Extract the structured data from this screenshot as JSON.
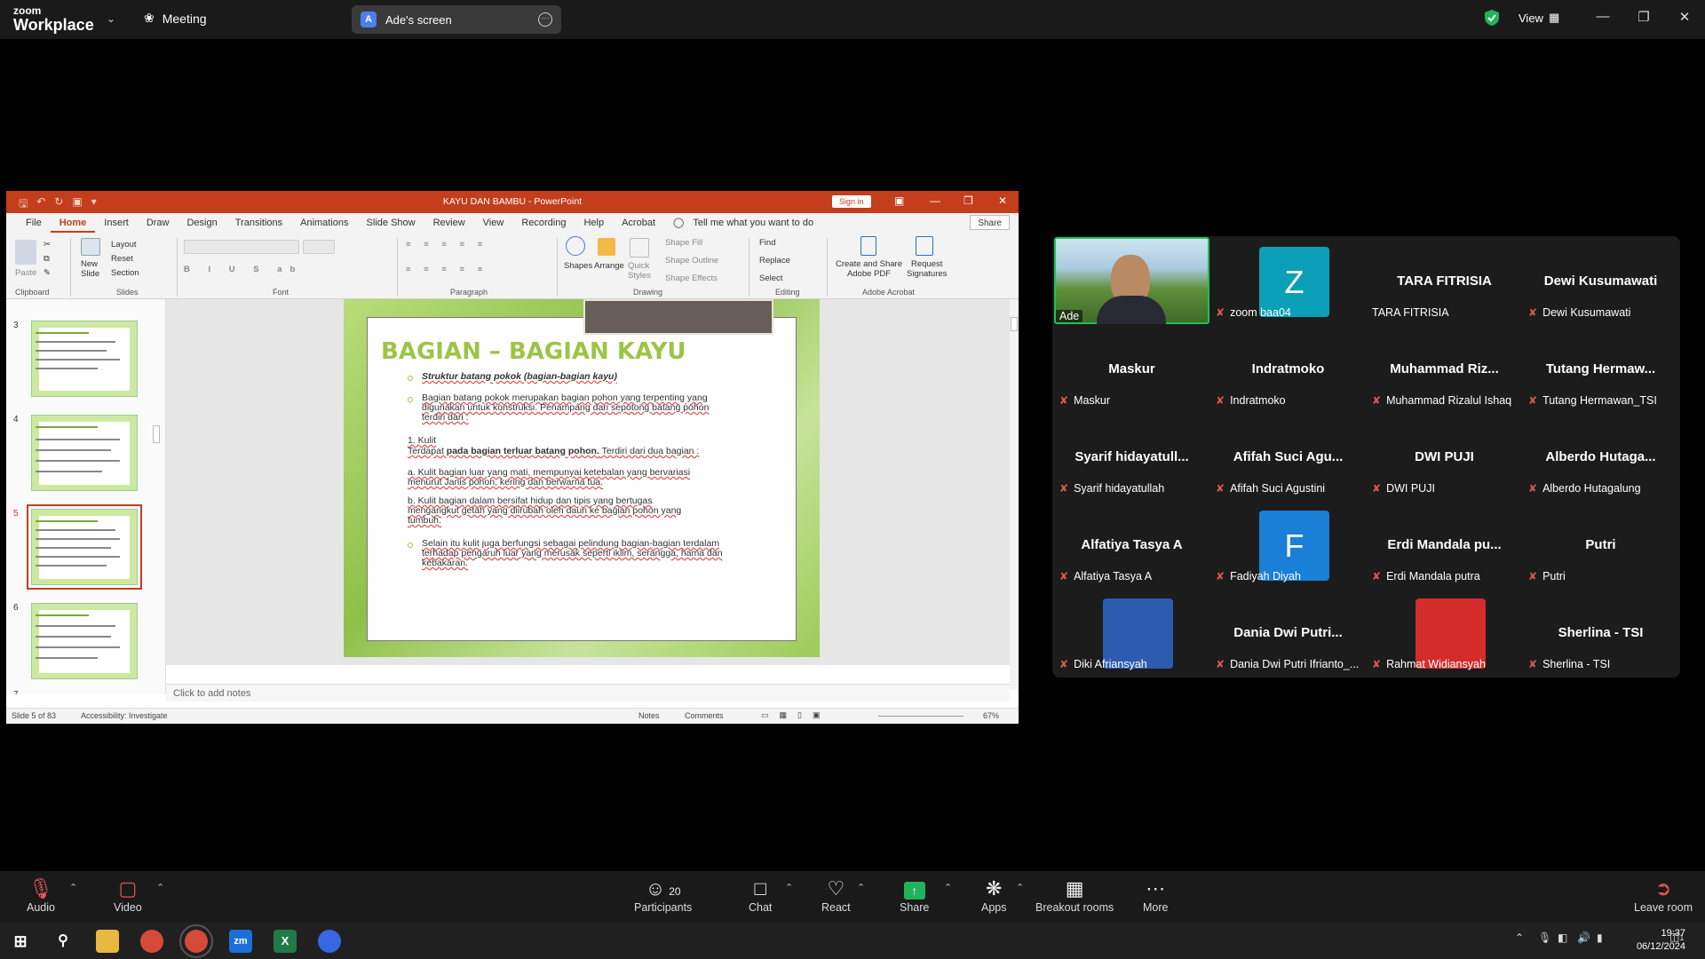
{
  "app": {
    "brand_line1": "zoom",
    "brand_line2": "Workplace",
    "meeting_label": "Meeting",
    "screen_share_label": "Ade's screen",
    "screen_badge": "A",
    "view_label": "View"
  },
  "ppt": {
    "title": "KAYU DAN BAMBU  -  PowerPoint",
    "sign_in": "Sign in",
    "tabs": [
      "File",
      "Home",
      "Insert",
      "Draw",
      "Design",
      "Transitions",
      "Animations",
      "Slide Show",
      "Review",
      "View",
      "Recording",
      "Help",
      "Acrobat"
    ],
    "tell_me": "Tell me what you want to do",
    "share": "Share",
    "ribbon": {
      "paste": "Paste",
      "new_slide": "New\nSlide",
      "layout": "Layout",
      "reset": "Reset",
      "section": "Section",
      "shapes": "Shapes",
      "arrange": "Arrange",
      "quick_styles": "Quick\nStyles",
      "shape_fill": "Shape Fill",
      "shape_outline": "Shape Outline",
      "shape_effects": "Shape Effects",
      "find": "Find",
      "replace": "Replace",
      "select": "Select",
      "create_share": "Create and Share\nAdobe PDF",
      "request_sig": "Request\nSignatures",
      "groups": {
        "clipboard": "Clipboard",
        "slides": "Slides",
        "font": "Font",
        "paragraph": "Paragraph",
        "drawing": "Drawing",
        "editing": "Editing",
        "adobe": "Adobe Acrobat"
      }
    },
    "thumb_numbers": [
      "3",
      "4",
      "5",
      "6",
      "7"
    ],
    "slide": {
      "title": "BAGIAN – BAGIAN KAYU",
      "b1": "Struktur batang pokok (bagian-bagian kayu)",
      "b2a": "Bagian batang pokok merupakan bagian pohon yang  terpenting yang",
      "b2b": "digunakan untuk konstruksi. Penampang dari sepotong batang pohon",
      "b2c": "terdiri dari :",
      "k1": "1. Kulit",
      "k2a": "Terdapat ",
      "k2b": "pada bagian terluar batang pohon.",
      "k2c": " Terdiri dari dua bagian :",
      "a1": "a. Kulit bagian luar yang mati, mempunyai ketebalan yang bervariasi",
      "a2": "menurut Janis pohon, kering dan berwarna tua.",
      "bb1": "b. Kulit bagian dalam bersifat hidup dan tipis yang bertugas",
      "bb2": "mengangkut getah yang diirubah oleh daun ke bagian pohon yang",
      "bb3": "tumbuh.",
      "c1": "Selain itu kulit juga berfungsi sebagai pelindung bagian-bagian terdalam",
      "c2": "terhadap pengaruh luar yang merusak seperti iklim, serangga, hama dan",
      "c3": "kebakaran."
    },
    "notes": "Click to add notes",
    "status_slide": "Slide 5 of 83",
    "accessibility": "Accessibility: Investigate",
    "notes_btn": "Notes",
    "comments_btn": "Comments",
    "zoom_pct": "67%"
  },
  "participants": [
    {
      "label": "Ade",
      "muted": false,
      "type": "video"
    },
    {
      "label": "zoom baa04",
      "muted": true,
      "type": "avatar",
      "initial": "Z",
      "color": "#0ca0b8"
    },
    {
      "name": "TARA FITRISIA",
      "label": "TARA FITRISIA",
      "muted": false
    },
    {
      "name": "Dewi Kusumawati",
      "label": "Dewi Kusumawati",
      "muted": true
    },
    {
      "name": "Maskur",
      "label": "Maskur",
      "muted": true
    },
    {
      "name": "Indratmoko",
      "label": "Indratmoko",
      "muted": true
    },
    {
      "name": "Muhammad  Riz...",
      "label": "Muhammad Rizalul Ishaq",
      "muted": true
    },
    {
      "name": "Tutang  Hermaw...",
      "label": "Tutang Hermawan_TSI",
      "muted": true
    },
    {
      "name": "Syarif  hidayatull...",
      "label": "Syarif hidayatullah",
      "muted": true
    },
    {
      "name": "Afifah Suci  Agu...",
      "label": "Afifah Suci Agustini",
      "muted": true
    },
    {
      "name": "DWI PUJI",
      "label": "DWI PUJI",
      "muted": true
    },
    {
      "name": "Alberdo  Hutaga...",
      "label": "Alberdo Hutagalung",
      "muted": true
    },
    {
      "name": "Alfatiya Tasya A",
      "label": "Alfatiya Tasya A",
      "muted": true
    },
    {
      "label": "Fadiyah Diyah",
      "muted": true,
      "type": "avatar",
      "initial": "F",
      "color": "#1a7fd6"
    },
    {
      "name": "Erdi Mandala  pu...",
      "label": "Erdi Mandala putra",
      "muted": true
    },
    {
      "name": "Putri",
      "label": "Putri",
      "muted": true
    },
    {
      "label": "Diki Afriansyah",
      "muted": true,
      "type": "photo",
      "color": "#2d5bb0"
    },
    {
      "name": "Dania Dwi  Putri...",
      "label": "Dania Dwi Putri Ifrianto_...",
      "muted": true
    },
    {
      "label": "Rahmat Widiansyah",
      "muted": true,
      "type": "photo",
      "color": "#d42b2b"
    },
    {
      "name": "Sherlina - TSI",
      "label": "Sherlina - TSI",
      "muted": true
    }
  ],
  "toolbar": {
    "audio": "Audio",
    "video": "Video",
    "participants": "Participants",
    "participants_count": "20",
    "chat": "Chat",
    "react": "React",
    "share": "Share",
    "apps": "Apps",
    "breakout": "Breakout rooms",
    "more": "More",
    "leave": "Leave room"
  },
  "taskbar": {
    "time": "19:37",
    "date": "06/12/2024",
    "notif_count": "1"
  }
}
